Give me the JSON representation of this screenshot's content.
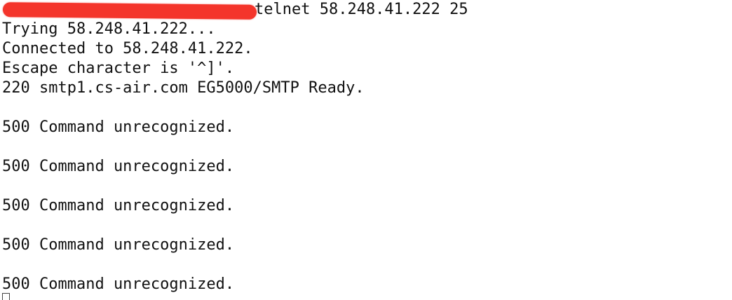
{
  "terminal": {
    "command_line": {
      "redacted_prompt": "",
      "command": "telnet 58.248.41.222 25"
    },
    "output_lines": [
      "Trying 58.248.41.222...",
      "Connected to 58.248.41.222.",
      "Escape character is '^]'.",
      "220 smtp1.cs-air.com EG5000/SMTP Ready.",
      "",
      "500 Command unrecognized.",
      "",
      "500 Command unrecognized.",
      "",
      "500 Command unrecognized.",
      "",
      "500 Command unrecognized.",
      "",
      "500 Command unrecognized."
    ],
    "redaction_color": "#f4352b",
    "cursor_style": "hollow-block"
  }
}
